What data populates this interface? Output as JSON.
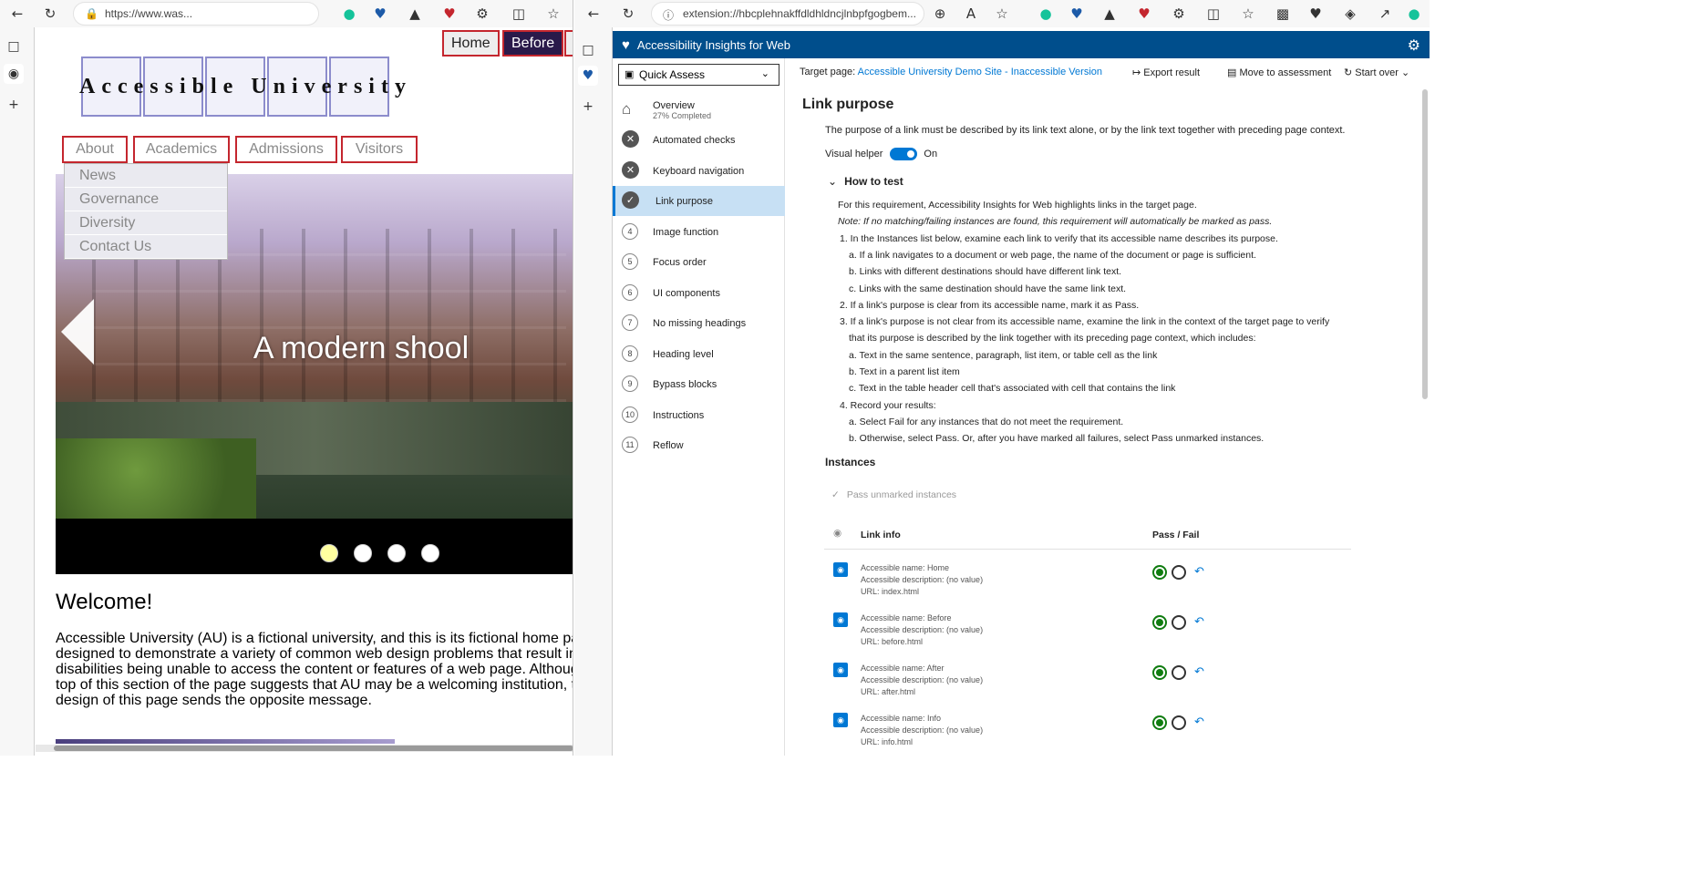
{
  "left_browser": {
    "address": "https://www.was...",
    "top_nav": [
      "Home",
      "Before"
    ],
    "logo_text": "Accessible University",
    "main_nav": [
      "About",
      "Academics",
      "Admissions",
      "Visitors"
    ],
    "about_dropdown": [
      "News",
      "Governance",
      "Diversity",
      "Contact Us"
    ],
    "hero_caption": "A modern shool",
    "carousel_dots": 4,
    "welcome_heading": "Welcome!",
    "body_lines": [
      "Accessible University (AU) is a fictional university, and this is its fictional home page. T",
      "designed to demonstrate a variety of common web design problems that result in visito",
      "disabilities being unable to access the content or features of a web page. Although the",
      "top of this section of the page suggests that AU may be a welcoming institution, the ina",
      "design of this page sends the opposite message."
    ]
  },
  "right_browser": {
    "address": "extension://hbcplehnakffdldhldncjlnbpfgogbem...",
    "app_title": "Accessibility Insights for Web",
    "quick_assess_label": "Quick Assess",
    "target_page_label": "Target page:",
    "target_page_link": "Accessible University Demo Site - Inaccessible Version",
    "commands": {
      "export": "Export result",
      "move": "Move to assessment",
      "start_over": "Start over"
    },
    "nav": {
      "overview": "Overview",
      "overview_sub": "27% Completed",
      "items": [
        {
          "num": "",
          "label": "Automated checks",
          "state": "failed"
        },
        {
          "num": "",
          "label": "Keyboard navigation",
          "state": "failed"
        },
        {
          "num": "",
          "label": "Link purpose",
          "state": "selected"
        },
        {
          "num": "4",
          "label": "Image function",
          "state": "none"
        },
        {
          "num": "5",
          "label": "Focus order",
          "state": "none"
        },
        {
          "num": "6",
          "label": "UI components",
          "state": "none"
        },
        {
          "num": "7",
          "label": "No missing headings",
          "state": "none"
        },
        {
          "num": "8",
          "label": "Heading level",
          "state": "none"
        },
        {
          "num": "9",
          "label": "Bypass blocks",
          "state": "none"
        },
        {
          "num": "10",
          "label": "Instructions",
          "state": "none"
        },
        {
          "num": "11",
          "label": "Reflow",
          "state": "none"
        }
      ]
    },
    "main": {
      "title": "Link purpose",
      "description": "The purpose of a link must be described by its link text alone, or by the link text together with preceding page context.",
      "visual_helper_label": "Visual helper",
      "visual_helper_state": "On",
      "how_to_test": "How to test",
      "instructions": [
        {
          "kind": "p",
          "text": "For this requirement, Accessibility Insights for Web highlights links in the target page."
        },
        {
          "kind": "note",
          "text": "Note: If no matching/failing instances are found, this requirement will automatically be marked as pass."
        },
        {
          "kind": "num",
          "text": "1. In the Instances list below, examine each link to verify that its accessible name describes its purpose."
        },
        {
          "kind": "sub",
          "text": "a. If a link navigates to a document or web page, the name of the document or page is sufficient."
        },
        {
          "kind": "sub",
          "text": "b. Links with different destinations should have different link text."
        },
        {
          "kind": "sub",
          "text": "c. Links with the same destination should have the same link text."
        },
        {
          "kind": "num",
          "text": "2. If a link's purpose is clear from its accessible name, mark it as Pass."
        },
        {
          "kind": "num",
          "text": "3. If a link's purpose is not clear from its accessible name, examine the link in the context of the target page to verify"
        },
        {
          "kind": "cont",
          "text": "that its purpose is described by the link together with its preceding page context, which includes:"
        },
        {
          "kind": "sub",
          "text": "a. Text in the same sentence, paragraph, list item, or table cell as the link"
        },
        {
          "kind": "sub",
          "text": "b. Text in a parent list item"
        },
        {
          "kind": "sub",
          "text": "c. Text in the table header cell that's associated with cell that contains the link"
        },
        {
          "kind": "num",
          "text": "4. Record your results:"
        },
        {
          "kind": "sub",
          "text": "a. Select Fail for any instances that do not meet the requirement."
        },
        {
          "kind": "sub",
          "text": "b. Otherwise, select Pass. Or, after you have marked all failures, select Pass unmarked instances."
        }
      ],
      "instances_title": "Instances",
      "pass_unmarked": "Pass unmarked instances",
      "col_link_info": "Link info",
      "col_pass_fail": "Pass / Fail",
      "rows": [
        {
          "name": "Accessible name: Home",
          "desc": "Accessible description: (no value)",
          "url": "URL: index.html"
        },
        {
          "name": "Accessible name: Before",
          "desc": "Accessible description: (no value)",
          "url": "URL: before.html"
        },
        {
          "name": "Accessible name: After",
          "desc": "Accessible description: (no value)",
          "url": "URL: after.html"
        },
        {
          "name": "Accessible name: Info",
          "desc": "Accessible description: (no value)",
          "url": "URL: info.html"
        }
      ]
    }
  },
  "colors": {
    "accent": "#0078d4",
    "header": "#004e8c",
    "outline_red": "#c4262e",
    "pass_green": "#107c10"
  }
}
